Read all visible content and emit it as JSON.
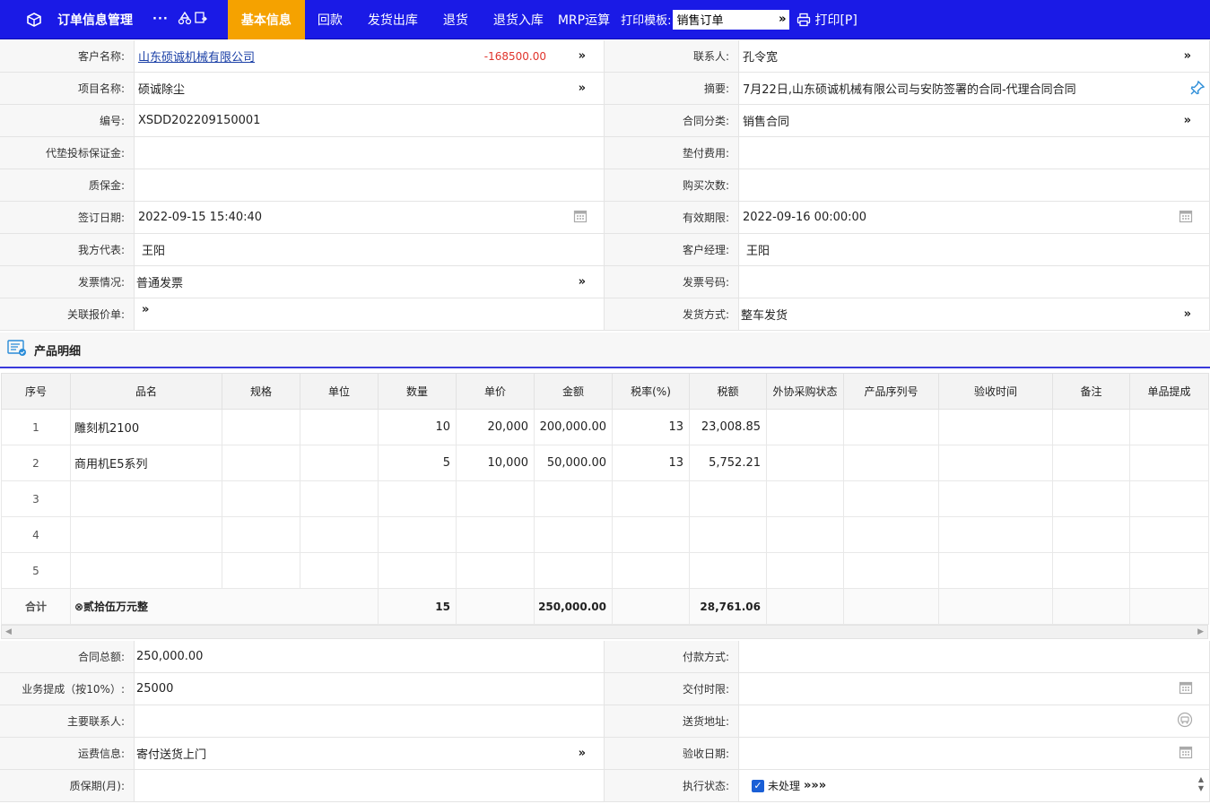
{
  "topbar": {
    "title": "订单信息管理",
    "more": "···",
    "tabs": [
      {
        "label": "基本信息",
        "active": true
      },
      {
        "label": "回款"
      },
      {
        "label": "发货出库"
      },
      {
        "label": "退货"
      },
      {
        "label": "退货入库"
      },
      {
        "label": "MRP运算"
      }
    ],
    "print_template_label": "打印模板:",
    "print_template_value": "销售订单",
    "print_label": "打印[P]"
  },
  "form_top": [
    {
      "l": "客户名称:",
      "v": "山东硕诚机械有限公司",
      "neg": "-168500.00",
      "arrow": "»",
      "rl": "联系人:",
      "rv": "孔令宽",
      "rarrow": "»"
    },
    {
      "l": "项目名称:",
      "v": "硕诚除尘",
      "arrow": "»",
      "rl": "摘要:",
      "rv": "7月22日,山东硕诚机械有限公司与安防签署的合同-代理合同合同"
    },
    {
      "l": "编号:",
      "v": "XSDD202209150001",
      "rl": "合同分类:",
      "rv": "销售合同",
      "rarrow": "»"
    },
    {
      "l": "代垫投标保证金:",
      "v": "",
      "rl": "垫付费用:",
      "rv": ""
    },
    {
      "l": "质保金:",
      "v": "",
      "rl": "购买次数:",
      "rv": ""
    },
    {
      "l": "签订日期:",
      "v": "2022-09-15 15:40:40",
      "rl": "有效期限:",
      "rv": "2022-09-16 00:00:00"
    },
    {
      "l": "我方代表:",
      "v": "王阳",
      "rl": "客户经理:",
      "rv": "王阳"
    },
    {
      "l": "发票情况:",
      "v": "普通发票",
      "arrow": "»",
      "rl": "发票号码:",
      "rv": ""
    },
    {
      "l": "关联报价单:",
      "v": "",
      "arrow": "»",
      "rl": "发货方式:",
      "rv": "整车发货",
      "rarrow": "»"
    }
  ],
  "section_title": "产品明细",
  "table": {
    "headers": [
      "序号",
      "品名",
      "规格",
      "单位",
      "数量",
      "单价",
      "金额",
      "税率(%)",
      "税额",
      "外协采购状态",
      "产品序列号",
      "验收时间",
      "备注",
      "单品提成"
    ],
    "rows": [
      [
        "1",
        "雕刻机2100",
        "",
        "",
        "10",
        "20,000",
        "200,000.00",
        "13",
        "23,008.85",
        "",
        "",
        "",
        "",
        ""
      ],
      [
        "2",
        "商用机E5系列",
        "",
        "",
        "5",
        "10,000",
        "50,000.00",
        "13",
        "5,752.21",
        "",
        "",
        "",
        "",
        ""
      ],
      [
        "3",
        "",
        "",
        "",
        "",
        "",
        "",
        "",
        "",
        "",
        "",
        "",
        "",
        ""
      ],
      [
        "4",
        "",
        "",
        "",
        "",
        "",
        "",
        "",
        "",
        "",
        "",
        "",
        "",
        ""
      ],
      [
        "5",
        "",
        "",
        "",
        "",
        "",
        "",
        "",
        "",
        "",
        "",
        "",
        "",
        ""
      ]
    ],
    "total": {
      "label": "合计",
      "words": "⊗贰拾伍万元整",
      "qty": "15",
      "amount": "250,000.00",
      "tax": "28,761.06"
    }
  },
  "form_bottom": [
    {
      "l": "合同总额:",
      "v": "250,000.00",
      "rl": "付款方式:",
      "rv": ""
    },
    {
      "l": "业务提成（按10%）:",
      "v": "25000",
      "rl": "交付时限:",
      "rv": ""
    },
    {
      "l": "主要联系人:",
      "v": "",
      "rl": "送货地址:",
      "rv": ""
    },
    {
      "l": "运费信息:",
      "v": "寄付送货上门",
      "arrow": "»",
      "rl": "验收日期:",
      "rv": ""
    },
    {
      "l": "质保期(月):",
      "v": "",
      "rl": "执行状态:",
      "rv": "未处理",
      "rarrow": "»»»"
    }
  ],
  "colors": {
    "topbar": "#1a1ae6",
    "active_tab": "#f5a200",
    "negative": "#e0342c",
    "link": "#1a3fa6"
  }
}
